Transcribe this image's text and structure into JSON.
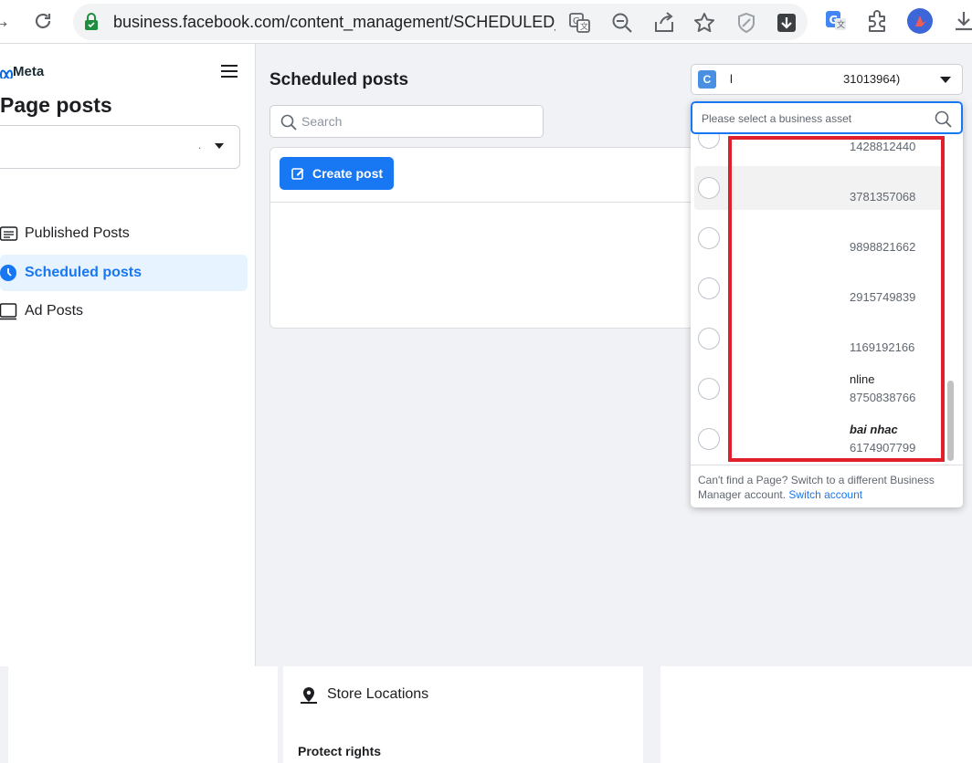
{
  "browser": {
    "url": "business.facebook.com/content_management/SCHEDULED_PC"
  },
  "sidebar": {
    "logo_text": "Meta",
    "title": "Page posts",
    "page_select_value": ".",
    "items": [
      {
        "label": "Published Posts",
        "active": false
      },
      {
        "label": "Scheduled posts",
        "active": true
      },
      {
        "label": "Ad Posts",
        "active": false
      }
    ]
  },
  "main": {
    "title": "Scheduled posts",
    "search_placeholder": "Search",
    "create_button": "Create post"
  },
  "account": {
    "badge": "C",
    "name": "l",
    "id": "31013964)"
  },
  "dropdown": {
    "search_placeholder": "Please select a business asset",
    "assets": [
      {
        "name": "",
        "id": "1428812440"
      },
      {
        "name": "",
        "id": "3781357068"
      },
      {
        "name": "",
        "id": "9898821662"
      },
      {
        "name": "",
        "id": "2915749839"
      },
      {
        "name": "",
        "id": "1169192166"
      },
      {
        "name": "nline",
        "id": "8750838766"
      },
      {
        "name": "bai nhac",
        "id": "6174907799"
      }
    ],
    "footer_text": "Can't find a Page? Switch to a different Business Manager account.",
    "footer_link": "Switch account"
  },
  "bottom": {
    "store_label": "Store Locations",
    "protect_label": "Protect rights"
  },
  "colors": {
    "accent": "#1877f2",
    "highlight": "#e0202b"
  }
}
